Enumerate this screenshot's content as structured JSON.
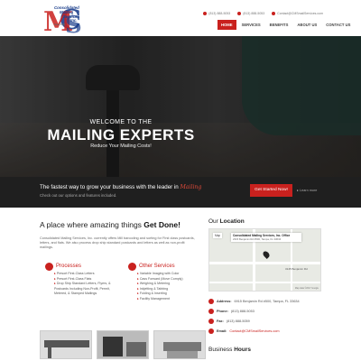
{
  "logo": {
    "line1": "Consolidated",
    "line2": "Mailing",
    "line3": "Services",
    "line4": "Inc.",
    "since": "Since 1985"
  },
  "contact": {
    "phone1": "(813) 888-5053",
    "phone2": "(813) 888-5053",
    "email": "Contact@CMSmailServices.com"
  },
  "nav": {
    "items": [
      "HOME",
      "SERVICES",
      "BENEFITS",
      "ABOUT US",
      "CONTACT US"
    ],
    "active": "HOME"
  },
  "hero": {
    "subtitle": "WELCOME TO THE",
    "title": "MAILING EXPERTS",
    "tagline": "Reduce Your Mailing Costs!"
  },
  "cta": {
    "main": "The fastest way to grow your business with the leader in",
    "brand": "Mailing",
    "sub": "Check out our options and features included.",
    "button": "Get Started Now!",
    "learn": "Learn more"
  },
  "main": {
    "title_pre": "A place where amazing things ",
    "title_bold": "Get Done!",
    "intro": "Consolidated Mailing Services, Inc. currently offers Mill barcoding and sorting for First class postcards, letters, and flats. We also process drop ship standard postcards and letters as well as non-profit mailings."
  },
  "processes": {
    "title": "Processes",
    "items": [
      "Presort First-Class Letters",
      "Presort First-Class Flats",
      "Drop Ship Standard Letters, Flyers, & Postcards Including Non-Profit, Permit, Metered, & Stamped Mailings"
    ]
  },
  "other_services": {
    "title": "Other Services",
    "items": [
      "Variable Imaging with Color",
      "Cass Forward (Move Comply)",
      "Weighing & Metering",
      "Inkjetting & Tabbing",
      "Folding & Inserting",
      "Facility Management"
    ]
  },
  "location": {
    "title_pre": "Our ",
    "title_bold": "Location",
    "map": {
      "type": "Map",
      "card_name": "Consolidated Mailing Services, Inc. Office",
      "card_address": "2315 Benjamin Rd #500, Tampa, FL 33634",
      "place": "3145 Benjamin Rd",
      "credit": "Map data ©2017 Google"
    },
    "address_label": "Address:",
    "address": "6915 Benjamin Rd #500, Tampa, FL 33634",
    "phone_label": "Phone:",
    "phone": "(813) 888-5053",
    "fax_label": "Fax:",
    "fax": "(813) 888-5059",
    "email_label": "Email:",
    "email": "Contact@CMSmailServices.com"
  },
  "hours": {
    "title_pre": "Business ",
    "title_bold": "Hours"
  },
  "colors": {
    "accent": "#c9211e",
    "dark": "#1f1f1f"
  }
}
